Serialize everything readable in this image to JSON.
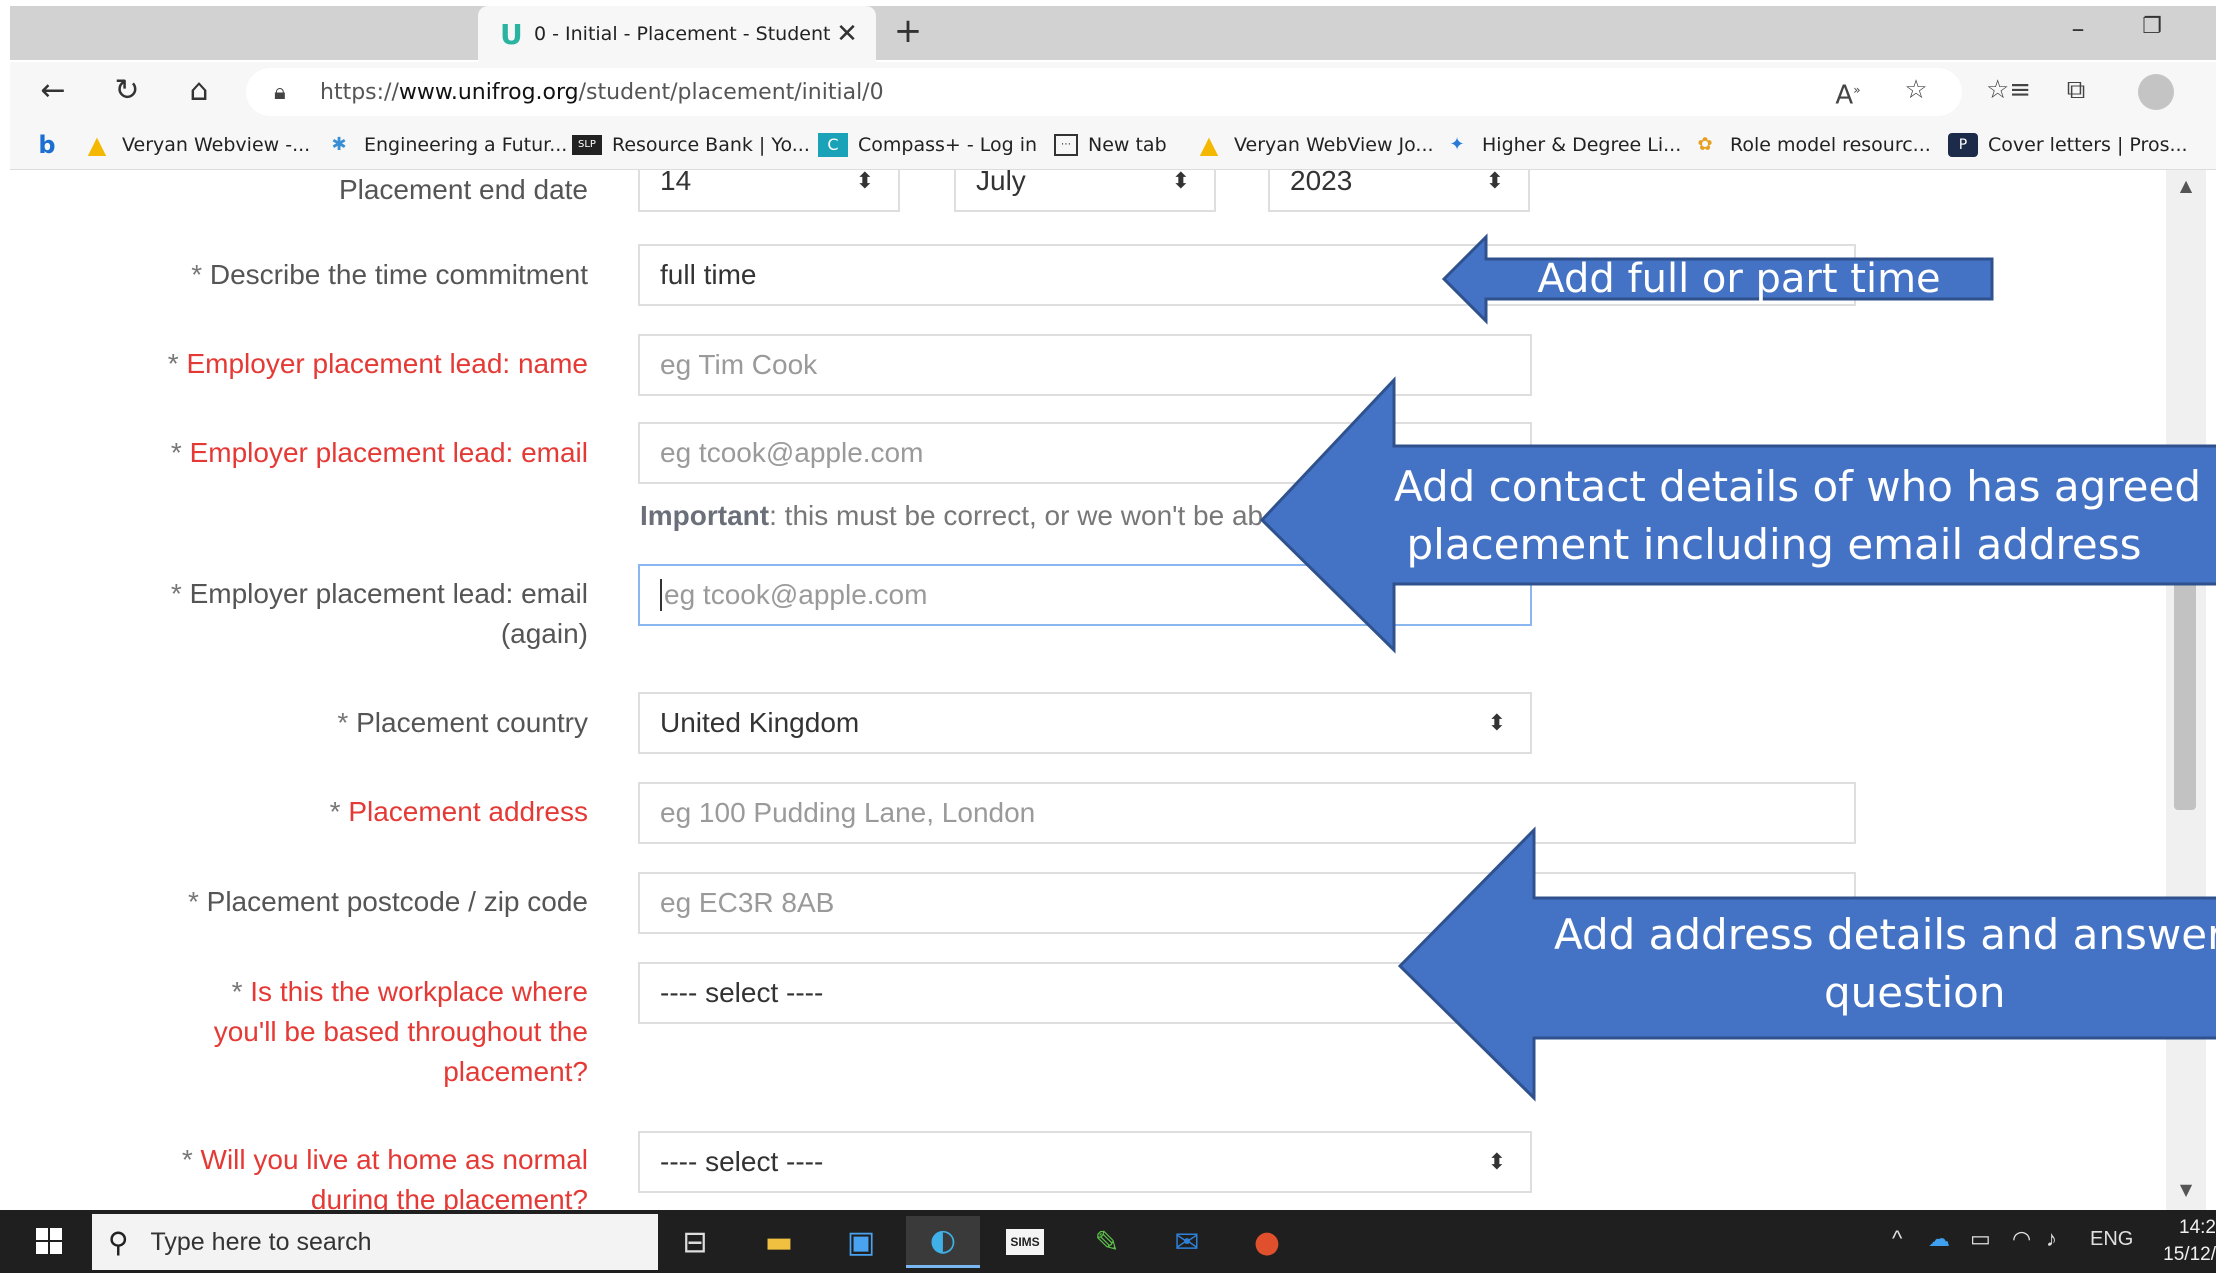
{
  "browser": {
    "tab_title": "0 - Initial - Placement - Student -",
    "tab_favicon": "U",
    "url_prefix": "https://",
    "url_domain": "www.unifrog.org",
    "url_path": "/student/placement/initial/0"
  },
  "favorites": [
    {
      "label": "Veryan Webview -...",
      "icon": "warning-triangle-icon"
    },
    {
      "label": "Engineering a Futur...",
      "icon": "engineering-icon"
    },
    {
      "label": "Resource Bank | Yo...",
      "icon": "slp-icon"
    },
    {
      "label": "Compass+ - Log in",
      "icon": "compass-icon"
    },
    {
      "label": "New tab",
      "icon": "new-tab-icon"
    },
    {
      "label": "Veryan WebView Jo...",
      "icon": "warning-triangle-icon"
    },
    {
      "label": "Higher & Degree Li...",
      "icon": "sparkle-icon"
    },
    {
      "label": "Role model resourc...",
      "icon": "role-model-icon"
    },
    {
      "label": "Cover letters | Pros...",
      "icon": "prospects-icon"
    }
  ],
  "form": {
    "end_date": {
      "label": "Placement end date",
      "day": "14",
      "month": "July",
      "year": "2023"
    },
    "time_commitment": {
      "label": "Describe the time commitment",
      "value": "full time"
    },
    "lead_name": {
      "label": "Employer placement lead: name",
      "placeholder": "eg Tim Cook"
    },
    "lead_email": {
      "label": "Employer placement lead: email",
      "placeholder": "eg tcook@apple.com"
    },
    "important_note": {
      "bold": "Important",
      "text": ": this must be correct, or we won't be ab"
    },
    "lead_email_again": {
      "label_line1": "Employer placement lead: email",
      "label_line2": "(again)",
      "placeholder": "eg tcook@apple.com"
    },
    "country": {
      "label": "Placement country",
      "value": "United Kingdom"
    },
    "address": {
      "label": "Placement address",
      "placeholder": "eg 100 Pudding Lane, London"
    },
    "postcode": {
      "label": "Placement postcode / zip code",
      "placeholder": "eg EC3R 8AB"
    },
    "workplace": {
      "label_line1": "Is this the workplace where",
      "label_line2": "you'll be based throughout the",
      "label_line3": "placement?",
      "value": "---- select ----"
    },
    "live_home": {
      "label_line1": "Will you live at home as normal",
      "label_line2": "during the placement?",
      "value": "---- select ----"
    },
    "required_star": "*"
  },
  "callouts": {
    "time": "Add full or part time",
    "contact_line1": "Add contact details of who has agreed",
    "contact_line2": "placement including email address",
    "address_line1": "Add address details and answer ea",
    "address_line2": "question",
    "color": "#4472c4",
    "border": "#2f528f"
  },
  "taskbar": {
    "search_placeholder": "Type here to search",
    "language": "ENG",
    "time": "14:2",
    "date": "15/12/"
  }
}
